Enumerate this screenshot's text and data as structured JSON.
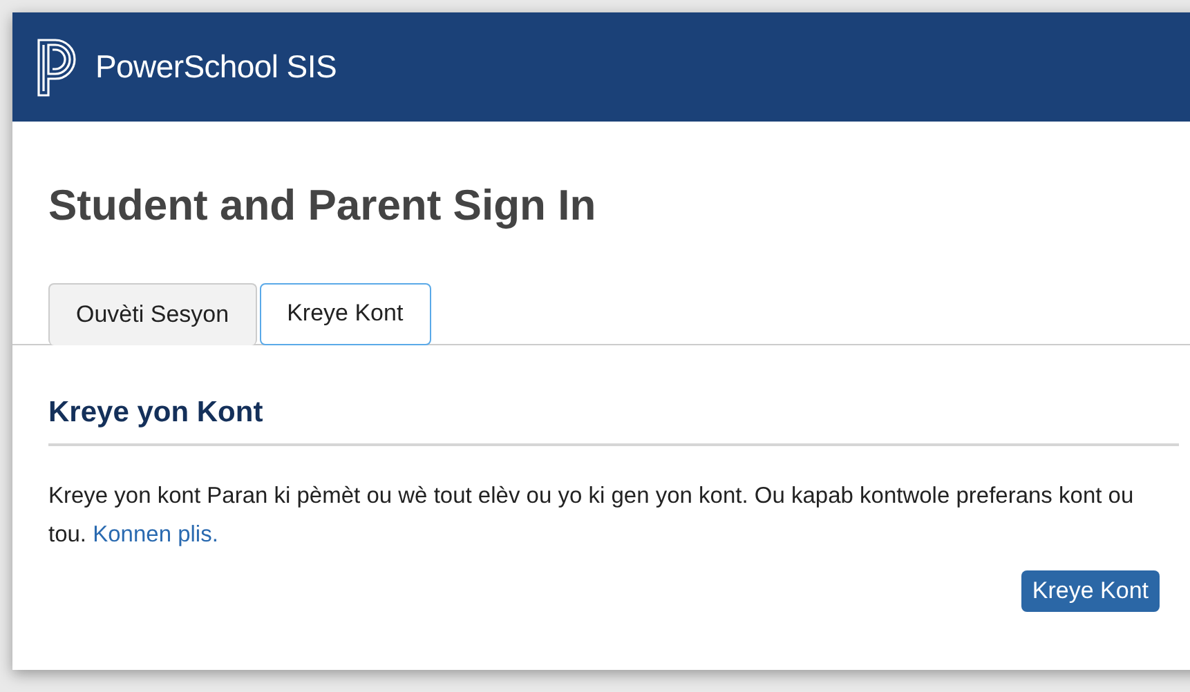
{
  "header": {
    "brand": "PowerSchool SIS"
  },
  "title": "Student and Parent Sign In",
  "tabs": [
    {
      "label": "Ouvèti Sesyon",
      "selected": false
    },
    {
      "label": "Kreye Kont",
      "selected": true
    }
  ],
  "section": {
    "heading": "Kreye yon Kont",
    "text": "Kreye yon kont Paran ki pèmèt ou wè tout elèv ou yo ki gen yon kont. Ou kapab kontwole preferans kont ou tou.",
    "link": "Konnen plis.",
    "button": "Kreye Kont"
  }
}
